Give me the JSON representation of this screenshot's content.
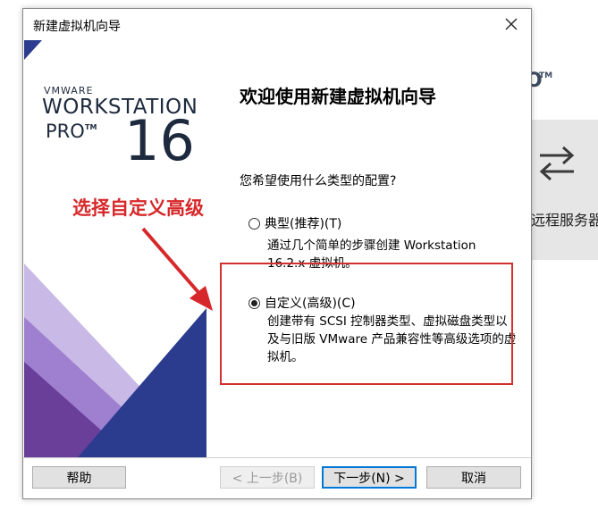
{
  "background": {
    "remote_label": "远程服务器",
    "logo_mark": "O",
    "logo_tm": "TM"
  },
  "dialog": {
    "title": "新建虚拟机向导",
    "close_label": "×"
  },
  "banner": {
    "vmware": "VMWARE",
    "workstation": "WORKSTATION",
    "pro": "PRO",
    "pro_tm": "TM",
    "version": "16",
    "colors": {
      "navy": "#1d2a3d",
      "blue": "#2b3c8f",
      "purple": "#6a3f9a",
      "lavender": "#c9b9e6"
    }
  },
  "content": {
    "heading": "欢迎使用新建虚拟机向导",
    "question": "您希望使用什么类型的配置?",
    "options": [
      {
        "label": "典型(推荐)(T)",
        "description": "通过几个简单的步骤创建 Workstation 16.2.x 虚拟机。",
        "checked": false
      },
      {
        "label": "自定义(高级)(C)",
        "description": "创建带有 SCSI 控制器类型、虚拟磁盘类型以及与旧版 VMware 产品兼容性等高级选项的虚拟机。",
        "checked": true
      }
    ]
  },
  "annotation": {
    "text": "选择自定义高级",
    "color": "#d6282a"
  },
  "buttons": {
    "help": "帮助",
    "back": "< 上一步(B)",
    "next": "下一步(N) >",
    "cancel": "取消"
  }
}
